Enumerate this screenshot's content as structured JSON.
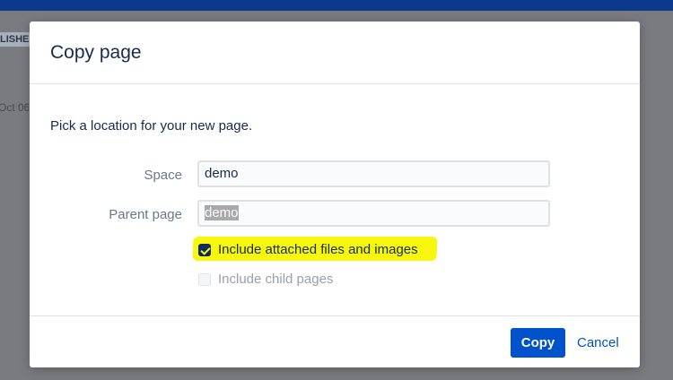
{
  "background": {
    "status_tag": "LISHE",
    "date_fragment": "Oct 06"
  },
  "dialog": {
    "title": "Copy page",
    "description": "Pick a location for your new page.",
    "fields": {
      "space": {
        "label": "Space",
        "value": "demo"
      },
      "parent": {
        "label": "Parent page",
        "value": "demo"
      }
    },
    "options": {
      "attachments": {
        "label": "Include attached files and images",
        "checked": true
      },
      "child_pages": {
        "label": "Include child pages",
        "checked": false,
        "disabled": true
      }
    },
    "actions": {
      "copy_label": "Copy",
      "cancel_label": "Cancel"
    }
  },
  "colors": {
    "primary": "#0052cc",
    "topbar": "#0b3a8c",
    "highlight": "#f6f70c",
    "text": "#172b4d",
    "muted": "#6b778c"
  }
}
